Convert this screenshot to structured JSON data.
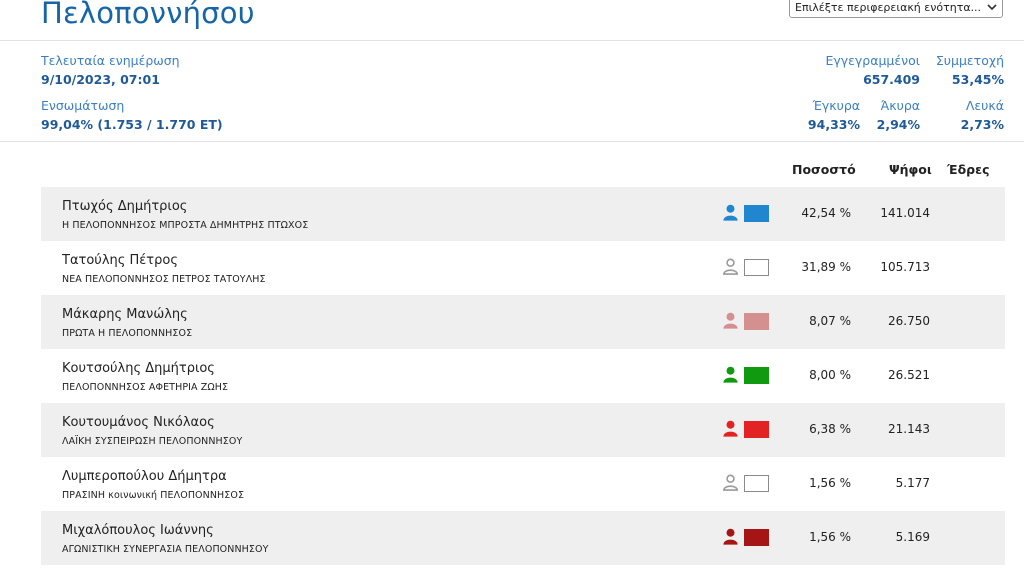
{
  "page": {
    "title": "Πελοποννήσου",
    "region_select": {
      "selected": "Επιλέξτε περιφερειακή ενότητα..."
    }
  },
  "summary": {
    "last_update_label": "Τελευταία ενημέρωση",
    "last_update_value": "9/10/2023, 07:01",
    "integration_label": "Ενσωμάτωση",
    "integration_value": "99,04% (1.753 / 1.770 ΕΤ)",
    "registered_label": "Εγγεγραμμένοι",
    "registered_value": "657.409",
    "turnout_label": "Συμμετοχή",
    "turnout_value": "53,45%",
    "valid_label": "Έγκυρα",
    "valid_value": "94,33%",
    "invalid_label": "Άκυρα",
    "invalid_value": "2,94%",
    "blank_label": "Λευκά",
    "blank_value": "2,73%"
  },
  "table": {
    "headers": {
      "percent": "Ποσοστό",
      "votes": "Ψήφοι",
      "seats": "Έδρες"
    },
    "rows": [
      {
        "candidate": "Πτωχός Δημήτριος",
        "party": "Η ΠΕΛΟΠΟΝΝΗΣΟΣ ΜΠΡΟΣΤΑ ΔΗΜΗΤΡΗΣ ΠΤΩΧΟΣ",
        "percent": "42,54 %",
        "votes": "141.014",
        "color": "#1f86cf",
        "person_color": "#1f86cf",
        "outlined": false
      },
      {
        "candidate": "Τατούλης Πέτρος",
        "party": "ΝΕΑ ΠΕΛΟΠΟΝΝΗΣΟΣ ΠΕΤΡΟΣ ΤΑΤΟΥΛΗΣ",
        "percent": "31,89 %",
        "votes": "105.713",
        "color": "#ffffff",
        "person_color": "#9a9a9a",
        "outlined": true
      },
      {
        "candidate": "Μάκαρης Μανώλης",
        "party": "ΠΡΩΤΑ Η ΠΕΛΟΠΟΝΝΗΣΟΣ",
        "percent": "8,07 %",
        "votes": "26.750",
        "color": "#d4908f",
        "person_color": "#d4908f",
        "outlined": false
      },
      {
        "candidate": "Κουτσούλης Δημήτριος",
        "party": "ΠΕΛΟΠΟΝΝΗΣΟΣ ΑΦΕΤΗΡΙΑ ΖΩΗΣ",
        "percent": "8,00 %",
        "votes": "26.521",
        "color": "#109a10",
        "person_color": "#109a10",
        "outlined": false
      },
      {
        "candidate": "Κουτουμάνος Νικόλαος",
        "party": "ΛΑΪΚΗ ΣΥΣΠΕΙΡΩΣΗ ΠΕΛΟΠΟΝΝΗΣΟΥ",
        "percent": "6,38 %",
        "votes": "21.143",
        "color": "#e32323",
        "person_color": "#e32323",
        "outlined": false
      },
      {
        "candidate": "Λυμπεροπούλου Δήμητρα",
        "party": "ΠΡΑΣΙΝΗ κοινωνική ΠΕΛΟΠΟΝΝΗΣΟΣ",
        "percent": "1,56 %",
        "votes": "5.177",
        "color": "#ffffff",
        "person_color": "#9a9a9a",
        "outlined": true
      },
      {
        "candidate": "Μιχαλόπουλος Ιωάννης",
        "party": "ΑΓΩΝΙΣΤΙΚΗ ΣΥΝΕΡΓΑΣΙΑ ΠΕΛΟΠΟΝΝΗΣΟΥ",
        "percent": "1,56 %",
        "votes": "5.169",
        "color": "#a51515",
        "person_color": "#a51515",
        "outlined": false
      }
    ]
  }
}
